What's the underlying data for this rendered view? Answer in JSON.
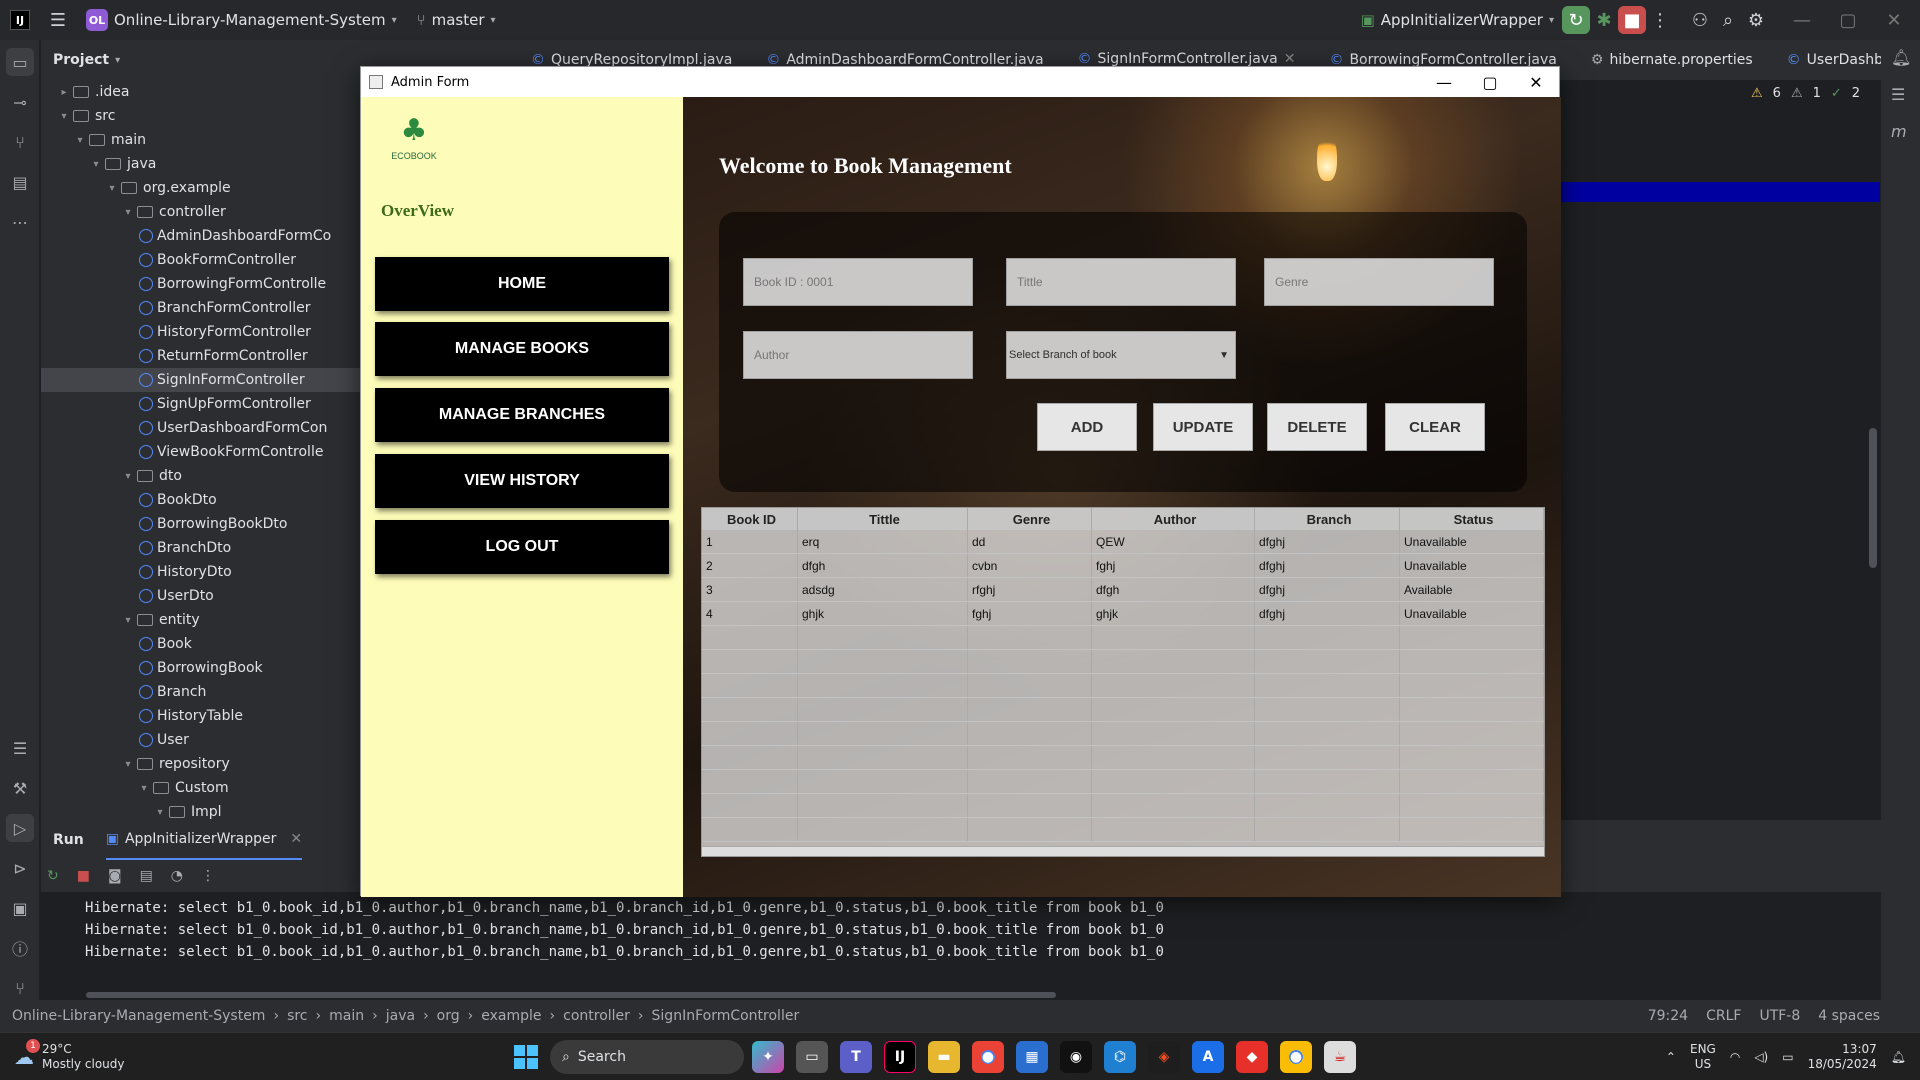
{
  "ide": {
    "project_badge": "OL",
    "project_name": "Online-Library-Management-System",
    "branch": "master",
    "run_config": "AppInitializerWrapper",
    "tabs": [
      "QueryRepositoryImpl.java",
      "AdminDashboardFormController.java",
      "SignInFormController.java",
      "BorrowingFormController.java",
      "hibernate.properties",
      "UserDashboar"
    ],
    "project_pane_title": "Project",
    "inspection_counts": {
      "warnings": "6",
      "weak": "1",
      "ok": "2"
    },
    "tree": [
      {
        "label": ".idea",
        "type": "folder",
        "depth": 1
      },
      {
        "label": "src",
        "type": "folder",
        "depth": 1
      },
      {
        "label": "main",
        "type": "folder",
        "depth": 2
      },
      {
        "label": "java",
        "type": "folder",
        "depth": 3
      },
      {
        "label": "org.example",
        "type": "folder",
        "depth": 4
      },
      {
        "label": "controller",
        "type": "folder",
        "depth": 5
      },
      {
        "label": "AdminDashboardFormCo",
        "type": "class",
        "depth": 6
      },
      {
        "label": "BookFormController",
        "type": "class",
        "depth": 6
      },
      {
        "label": "BorrowingFormControlle",
        "type": "class",
        "depth": 6
      },
      {
        "label": "BranchFormController",
        "type": "class",
        "depth": 6
      },
      {
        "label": "HistoryFormController",
        "type": "class",
        "depth": 6
      },
      {
        "label": "ReturnFormController",
        "type": "class",
        "depth": 6
      },
      {
        "label": "SignInFormController",
        "type": "class",
        "depth": 6
      },
      {
        "label": "SignUpFormController",
        "type": "class",
        "depth": 6
      },
      {
        "label": "UserDashboardFormCon",
        "type": "class",
        "depth": 6
      },
      {
        "label": "ViewBookFormControlle",
        "type": "class",
        "depth": 6
      },
      {
        "label": "dto",
        "type": "folder",
        "depth": 5
      },
      {
        "label": "BookDto",
        "type": "class",
        "depth": 6
      },
      {
        "label": "BorrowingBookDto",
        "type": "class",
        "depth": 6
      },
      {
        "label": "BranchDto",
        "type": "class",
        "depth": 6
      },
      {
        "label": "HistoryDto",
        "type": "class",
        "depth": 6
      },
      {
        "label": "UserDto",
        "type": "class",
        "depth": 6
      },
      {
        "label": "entity",
        "type": "folder",
        "depth": 5
      },
      {
        "label": "Book",
        "type": "class",
        "depth": 6
      },
      {
        "label": "BorrowingBook",
        "type": "class",
        "depth": 6
      },
      {
        "label": "Branch",
        "type": "class",
        "depth": 6
      },
      {
        "label": "HistoryTable",
        "type": "class",
        "depth": 6
      },
      {
        "label": "User",
        "type": "class",
        "depth": 6
      },
      {
        "label": "repository",
        "type": "folder",
        "depth": 5
      },
      {
        "label": "Custom",
        "type": "folder",
        "depth": 6
      },
      {
        "label": "Impl",
        "type": "folder",
        "depth": 7
      }
    ],
    "run_tab": "Run",
    "run_config_tab": "AppInitializerWrapper",
    "console_lines": [
      "Hibernate: select b1_0.book_id,b1_0.author,b1_0.branch_name,b1_0.branch_id,b1_0.genre,b1_0.status,b1_0.book_title from book b1_0",
      "Hibernate: select b1_0.book_id,b1_0.author,b1_0.branch_name,b1_0.branch_id,b1_0.genre,b1_0.status,b1_0.book_title from book b1_0",
      "Hibernate: select b1_0.book_id,b1_0.author,b1_0.branch_name,b1_0.branch_id,b1_0.genre,b1_0.status,b1_0.book_title from book b1_0"
    ],
    "breadcrumb": [
      "Online-Library-Management-System",
      "src",
      "main",
      "java",
      "org",
      "example",
      "controller",
      "SignInFormController"
    ],
    "status": {
      "position": "79:24",
      "line_sep": "CRLF",
      "encoding": "UTF-8",
      "indent": "4 spaces"
    }
  },
  "form": {
    "window_title": "Admin Form",
    "brand": "ECOBOOK",
    "overview": "OverView",
    "nav": [
      "HOME",
      "MANAGE BOOKS",
      "MANAGE BRANCHES",
      "VIEW HISTORY",
      "LOG OUT"
    ],
    "welcome": "Welcome to Book Management",
    "fields": {
      "book_id": "Book ID : 0001",
      "title": "Tittle",
      "genre": "Genre",
      "author": "Author",
      "branch": "Select Branch of book"
    },
    "actions": [
      "ADD",
      "UPDATE",
      "DELETE",
      "CLEAR"
    ],
    "table": {
      "headers": [
        "Book ID",
        "Tittle",
        "Genre",
        "Author",
        "Branch",
        "Status"
      ],
      "rows": [
        [
          "1",
          "erq",
          "dd",
          "QEW",
          "dfghj",
          "Unavailable"
        ],
        [
          "2",
          "dfgh",
          "cvbn",
          "fghj",
          "dfghj",
          "Unavailable"
        ],
        [
          "3",
          "adsdg",
          "rfghj",
          "dfgh",
          "dfghj",
          "Available"
        ],
        [
          "4",
          "ghjk",
          "fghj",
          "ghjk",
          "dfghj",
          "Unavailable"
        ]
      ]
    }
  },
  "taskbar": {
    "weather_temp": "29°C",
    "weather_desc": "Mostly cloudy",
    "weather_badge": "1",
    "search": "Search",
    "lang": "ENG",
    "region": "US",
    "time": "13:07",
    "date": "18/05/2024"
  }
}
